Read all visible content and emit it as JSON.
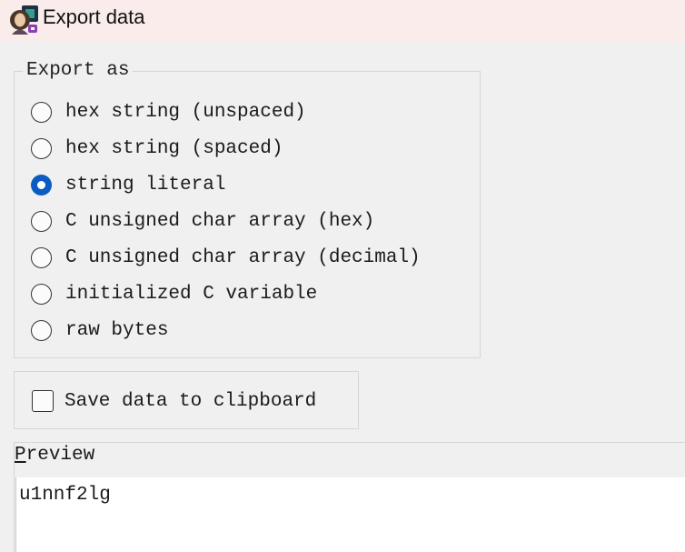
{
  "window": {
    "title": "Export data",
    "icon": "portrait-app-icon"
  },
  "export_group": {
    "legend": "Export as",
    "options": [
      {
        "label": "hex string (unspaced)",
        "checked": false
      },
      {
        "label": "hex string (spaced)",
        "checked": false
      },
      {
        "label": "string literal",
        "checked": true
      },
      {
        "label": "C unsigned char array (hex)",
        "checked": false
      },
      {
        "label": "C unsigned char array (decimal)",
        "checked": false
      },
      {
        "label": "initialized C variable",
        "checked": false
      },
      {
        "label": "raw bytes",
        "checked": false
      }
    ]
  },
  "clipboard": {
    "label": "Save data to clipboard",
    "checked": false
  },
  "preview": {
    "label_mnemonic": "P",
    "label_rest": "review",
    "text": "u1nnf2lg"
  },
  "colors": {
    "titlebar_bg": "#f9ecea",
    "accent": "#0a5cc2",
    "window_bg": "#f0f0f0"
  }
}
